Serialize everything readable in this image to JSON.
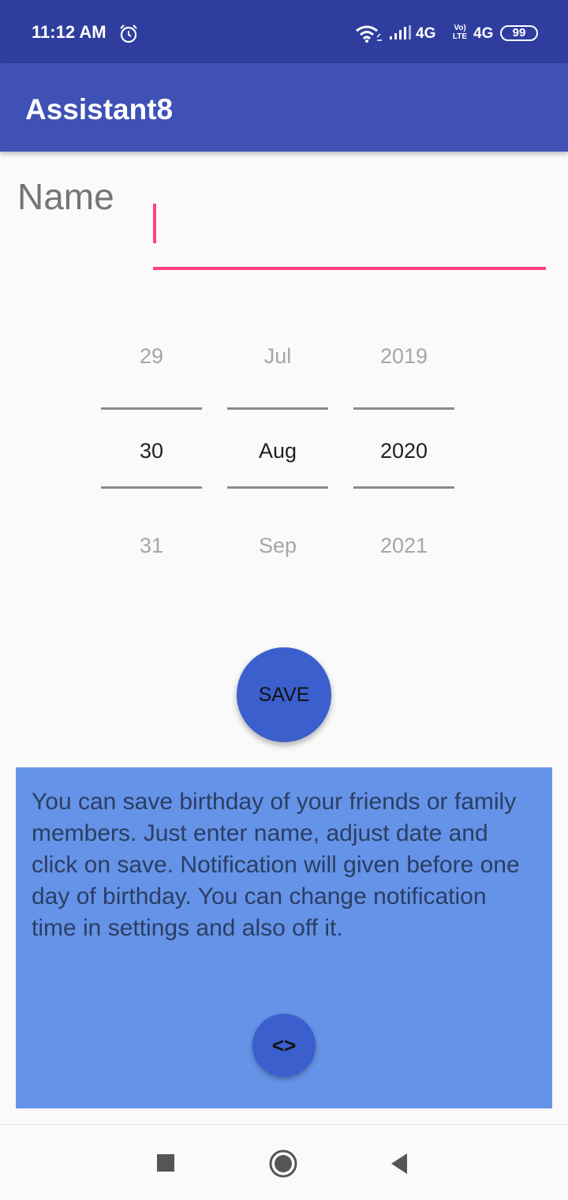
{
  "status_bar": {
    "time": "11:12 AM",
    "icons": [
      "alarm-icon",
      "wifi-icon",
      "signal-icon",
      "volte-icon",
      "battery-icon"
    ],
    "network_1": "4G",
    "volte": "Vo) LTE",
    "network_2": "4G",
    "battery": "99"
  },
  "app_bar": {
    "title": "Assistant8",
    "color": "#3f51b5"
  },
  "form": {
    "name_label": "Name",
    "name_value": "",
    "accent_color": "#ff4081"
  },
  "date_picker": {
    "day": {
      "prev": "29",
      "current": "30",
      "next": "31"
    },
    "month": {
      "prev": "Jul",
      "current": "Aug",
      "next": "Sep"
    },
    "year": {
      "prev": "2019",
      "current": "2020",
      "next": "2021"
    }
  },
  "save_button": {
    "label": "SAVE",
    "color": "#3b5fcc"
  },
  "info_panel": {
    "text": "You can save birthday of your friends or family members. Just enter name, adjust date and click on save. Notification will given before one day of birthday. You can change notification time in settings and also off it.",
    "toggle_label": "<>",
    "background": "#6593e8"
  },
  "nav_bar": {
    "icons": [
      "recents-icon",
      "home-icon",
      "back-icon"
    ]
  }
}
